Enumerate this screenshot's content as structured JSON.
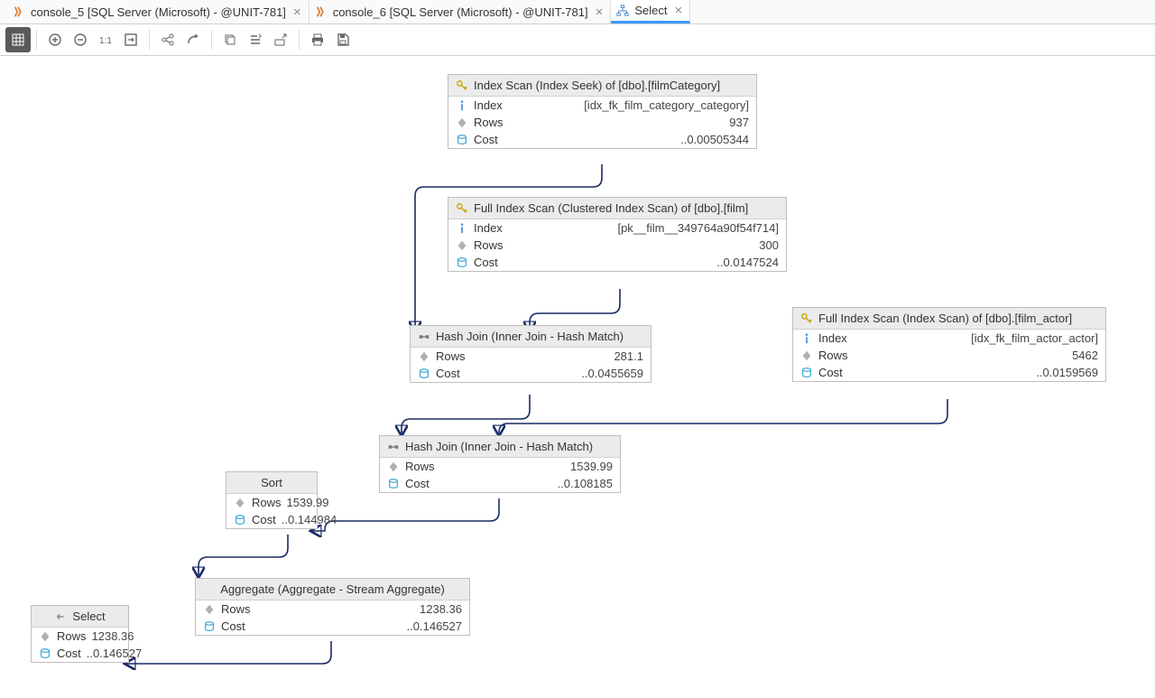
{
  "tabs": [
    {
      "label": "console_5 [SQL Server (Microsoft) - @UNIT-781]"
    },
    {
      "label": "console_6 [SQL Server (Microsoft) - @UNIT-781]"
    },
    {
      "label": "Select",
      "active": true
    }
  ],
  "nodes": {
    "n1": {
      "title": "Index Scan (Index Seek) of [dbo].[filmCategory]",
      "index": "[idx_fk_film_category_category]",
      "rows": "937",
      "cost": "..0.00505344",
      "labels": {
        "index": "Index",
        "rows": "Rows",
        "cost": "Cost"
      }
    },
    "n2": {
      "title": "Full Index Scan (Clustered Index Scan) of [dbo].[film]",
      "index": "[pk__film__349764a90f54f714]",
      "rows": "300",
      "cost": "..0.0147524",
      "labels": {
        "index": "Index",
        "rows": "Rows",
        "cost": "Cost"
      }
    },
    "n3": {
      "title": "Hash Join (Inner Join - Hash Match)",
      "rows": "281.1",
      "cost": "..0.0455659",
      "labels": {
        "rows": "Rows",
        "cost": "Cost"
      }
    },
    "n4": {
      "title": "Full Index Scan (Index Scan) of [dbo].[film_actor]",
      "index": "[idx_fk_film_actor_actor]",
      "rows": "5462",
      "cost": "..0.0159569",
      "labels": {
        "index": "Index",
        "rows": "Rows",
        "cost": "Cost"
      }
    },
    "n5": {
      "title": "Hash Join (Inner Join - Hash Match)",
      "rows": "1539.99",
      "cost": "..0.108185",
      "labels": {
        "rows": "Rows",
        "cost": "Cost"
      }
    },
    "n6": {
      "title": "Sort",
      "rows": "1539.99",
      "cost": "..0.144984",
      "labels": {
        "rows": "Rows",
        "cost": "Cost"
      }
    },
    "n7": {
      "title": "Aggregate (Aggregate - Stream Aggregate)",
      "rows": "1238.36",
      "cost": "..0.146527",
      "labels": {
        "rows": "Rows",
        "cost": "Cost"
      }
    },
    "n8": {
      "title": "Select",
      "rows": "1238.36",
      "cost": "..0.146527",
      "labels": {
        "rows": "Rows",
        "cost": "Cost"
      }
    }
  }
}
